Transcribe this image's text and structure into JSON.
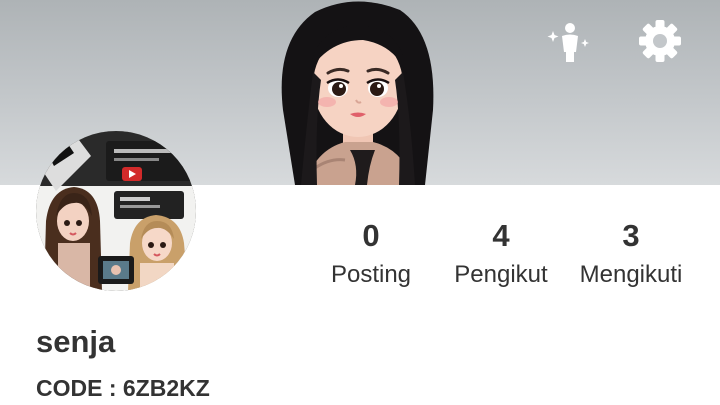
{
  "header": {
    "avatar_edit_icon": "avatar-sparkle-icon",
    "settings_icon": "gear-icon"
  },
  "stats": [
    {
      "value": "0",
      "label": "Posting"
    },
    {
      "value": "4",
      "label": "Pengikut"
    },
    {
      "value": "3",
      "label": "Mengikuti"
    }
  ],
  "profile": {
    "name": "senja",
    "code_label": "CODE : ",
    "code_value": "6ZB2KZ"
  },
  "colors": {
    "banner_top": "#aeb3b6",
    "banner_bottom": "#d7dadc",
    "text": "#333333",
    "background": "#ffffff"
  }
}
